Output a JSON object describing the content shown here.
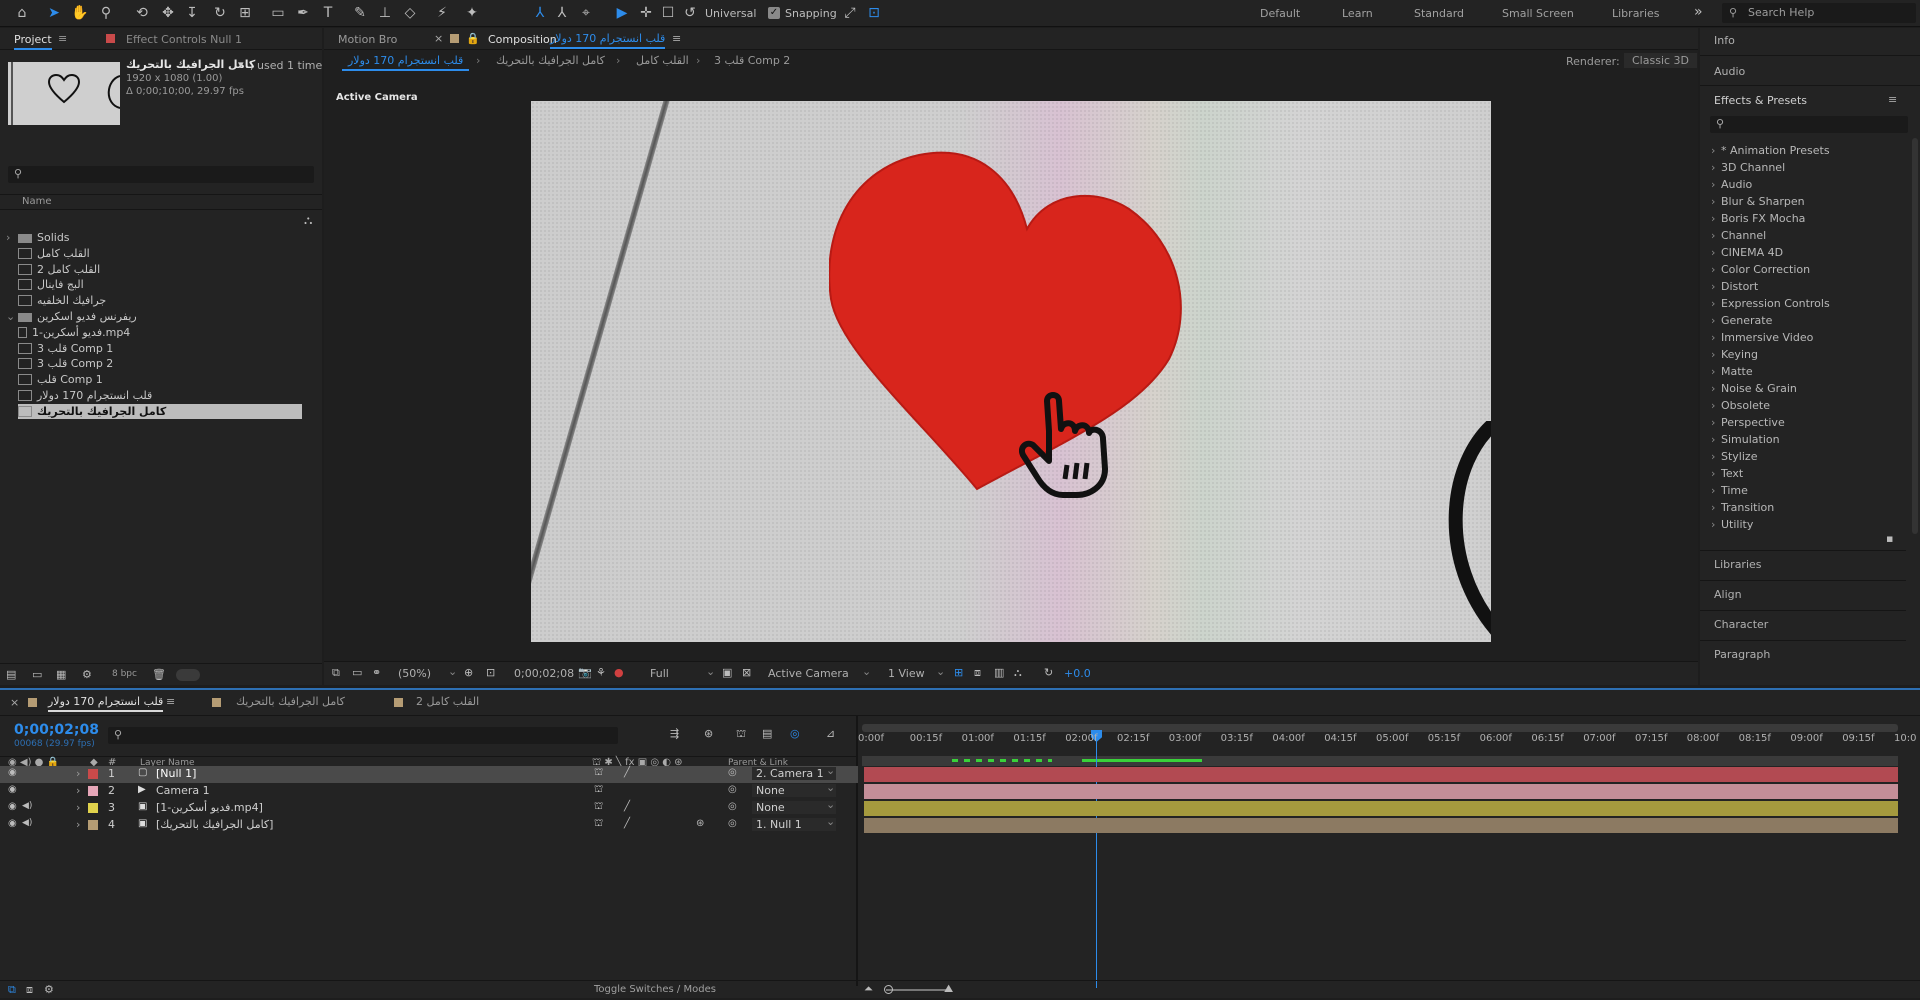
{
  "toolbar": {
    "universal": "Universal",
    "snapping": "Snapping",
    "workspaces": [
      "Default",
      "Learn",
      "Standard",
      "Small Screen",
      "Libraries"
    ],
    "more": "»",
    "search": "Search Help"
  },
  "project": {
    "tab": "Project",
    "effect_controls": "Effect Controls Null 1",
    "comp_name": "كامل الجرافيك بالتحريك",
    "used": ", used 1 time",
    "size": "1920 x 1080 (1.00)",
    "duration": "Δ 0;00;10;00, 29.97 fps",
    "name_header": "Name",
    "bpc": "8 bpc",
    "items": [
      {
        "label": "Solids",
        "type": "folder"
      },
      {
        "label": "القلب كامل",
        "type": "comp"
      },
      {
        "label": "القلب كامل 2",
        "type": "comp"
      },
      {
        "label": "البج فاينال",
        "type": "comp"
      },
      {
        "label": "جرافيك الخلفيه",
        "type": "comp"
      },
      {
        "label": "ريفرنس فديو اسكرين",
        "type": "folder"
      },
      {
        "label": "فديو أسكرين-1.mp4",
        "type": "file"
      },
      {
        "label": "قلب 3 Comp 1",
        "type": "comp"
      },
      {
        "label": "قلب 3 Comp 2",
        "type": "comp"
      },
      {
        "label": "قلب Comp 1",
        "type": "comp"
      },
      {
        "label": "قلب انستجرام 170 دولار",
        "type": "comp"
      },
      {
        "label": "كامل الجرافيك بالتحريك",
        "type": "comp",
        "selected": true
      }
    ]
  },
  "composition": {
    "motion_bro": "Motion Bro",
    "tab_label": "Composition",
    "comp_name": "قلب انستجرام 170 دولار",
    "breadcrumbs": [
      "قلب انستجرام 170 دولار",
      "كامل الجرافيك بالتحريك",
      "القلب كامل",
      "قلب 3 Comp 2"
    ],
    "renderer_label": "Renderer:",
    "renderer": "Classic 3D",
    "active_camera": "Active Camera",
    "zoom": "(50%)",
    "timecode": "0;00;02;08",
    "resolution": "Full",
    "camera_view": "Active Camera",
    "views": "1 View",
    "exposure": "+0.0"
  },
  "right_panel": {
    "info": "Info",
    "audio": "Audio",
    "effects_title": "Effects & Presets",
    "effects": [
      "* Animation Presets",
      "3D Channel",
      "Audio",
      "Blur & Sharpen",
      "Boris FX Mocha",
      "Channel",
      "CINEMA 4D",
      "Color Correction",
      "Distort",
      "Expression Controls",
      "Generate",
      "Immersive Video",
      "Keying",
      "Matte",
      "Noise & Grain",
      "Obsolete",
      "Perspective",
      "Simulation",
      "Stylize",
      "Text",
      "Time",
      "Transition",
      "Utility"
    ],
    "sections": [
      "Libraries",
      "Align",
      "Character",
      "Paragraph"
    ]
  },
  "timeline": {
    "tabs": [
      "قلب انستجرام 170 دولار",
      "كامل الجرافيك بالتحريك",
      "القلب كامل 2"
    ],
    "timecode": "0;00;02;08",
    "frames": "00068 (29.97 fps)",
    "layer_name_header": "Layer Name",
    "parent_header": "Parent & Link",
    "toggle": "Toggle Switches / Modes",
    "ruler": [
      "0:00f",
      "00:15f",
      "01:00f",
      "01:15f",
      "02:00f",
      "02:15f",
      "03:00f",
      "03:15f",
      "04:00f",
      "04:15f",
      "05:00f",
      "05:15f",
      "06:00f",
      "06:15f",
      "07:00f",
      "07:15f",
      "08:00f",
      "08:15f",
      "09:00f",
      "09:15f",
      "10:0"
    ],
    "layers": [
      {
        "num": "1",
        "name": "[Null 1]",
        "label_color": "#c94a4a",
        "parent": "2. Camera 1",
        "bar_color": "#b24a52"
      },
      {
        "num": "2",
        "name": "Camera 1",
        "label_color": "#e6a6b8",
        "parent": "None",
        "bar_color": "#c48e98"
      },
      {
        "num": "3",
        "name": "[فديو أسكرين-1.mp4]",
        "label_color": "#e0d24c",
        "parent": "None",
        "bar_color": "#a59a3e"
      },
      {
        "num": "4",
        "name": "[كامل الجرافيك بالتحريك]",
        "label_color": "#b59c74",
        "parent": "1. Null 1",
        "bar_color": "#8c7a62"
      }
    ]
  },
  "colors": {
    "accent": "#2d8ceb",
    "heart": "#d8251c"
  }
}
